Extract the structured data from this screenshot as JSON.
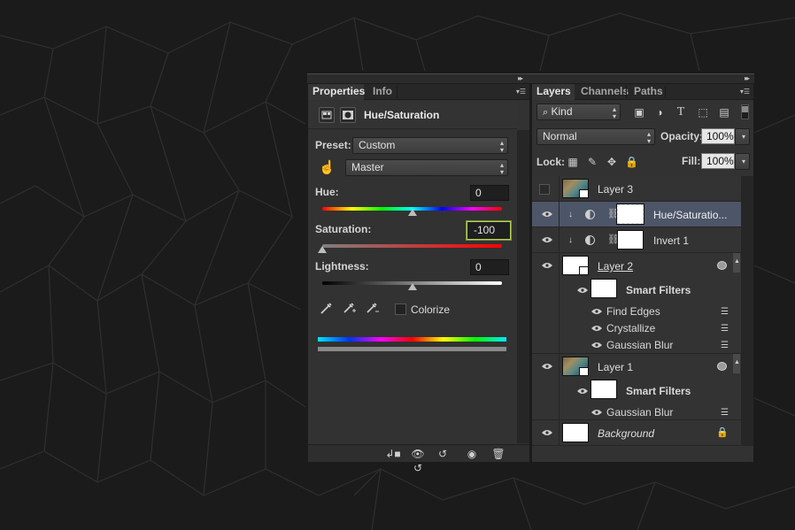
{
  "properties_panel": {
    "tabs": [
      {
        "label": "Properties",
        "active": true
      },
      {
        "label": "Info",
        "active": false
      }
    ],
    "adjustment_title": "Hue/Saturation",
    "preset": {
      "label": "Preset:",
      "value": "Custom"
    },
    "channel": {
      "value": "Master"
    },
    "hue": {
      "label": "Hue:",
      "value": "0"
    },
    "saturation": {
      "label": "Saturation:",
      "value": "-100"
    },
    "lightness": {
      "label": "Lightness:",
      "value": "0"
    },
    "colorize": {
      "label": "Colorize",
      "checked": false
    },
    "slider_levels": {
      "hue": 0.5,
      "saturation": 0.0,
      "lightness": 0.5
    }
  },
  "layers_panel": {
    "tabs": [
      {
        "label": "Layers",
        "active": true
      },
      {
        "label": "Channels",
        "active": false
      },
      {
        "label": "Paths",
        "active": false
      }
    ],
    "filter_kind": "Kind",
    "blend_mode": "Normal",
    "opacity": {
      "label": "Opacity:",
      "value": "100%"
    },
    "lock": {
      "label": "Lock:"
    },
    "fill": {
      "label": "Fill:",
      "value": "100%"
    },
    "layers": [
      {
        "name": "Layer 3",
        "visible": false
      },
      {
        "name": "Hue/Saturatio...",
        "visible": true,
        "selected": true
      },
      {
        "name": "Invert 1",
        "visible": true
      },
      {
        "name": "Layer 2",
        "visible": true,
        "smart_filters_label": "Smart Filters",
        "filters": [
          "Find Edges",
          "Crystallize",
          "Gaussian Blur"
        ]
      },
      {
        "name": "Layer 1",
        "visible": true,
        "smart_filters_label": "Smart Filters",
        "filters": [
          "Gaussian Blur"
        ]
      },
      {
        "name": "Background",
        "visible": true,
        "locked": true
      }
    ]
  },
  "colors": {
    "accent_focus": "#b6d35a",
    "selected_row": "#4d5568",
    "panel_bg": "#323232"
  }
}
